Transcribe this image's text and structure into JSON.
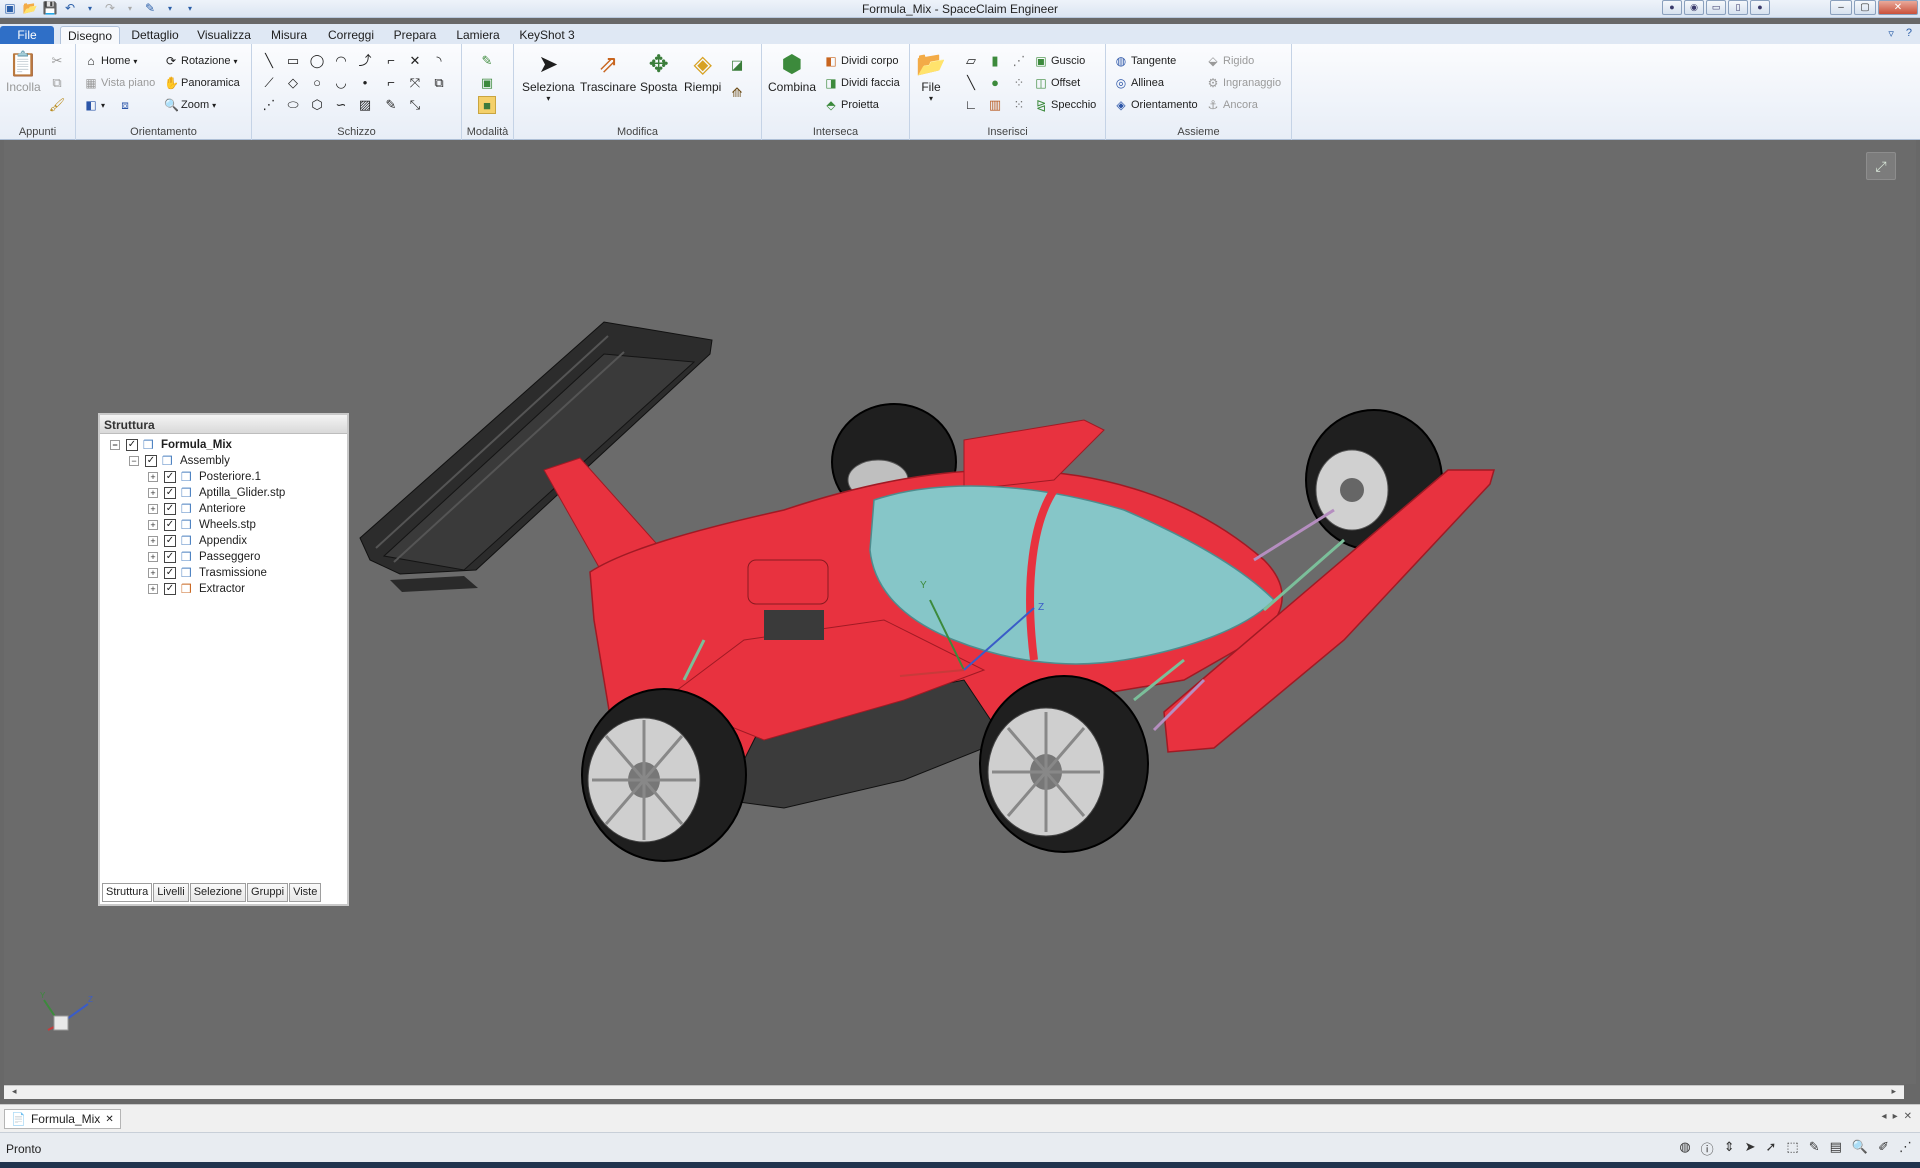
{
  "window": {
    "title": "Formula_Mix - SpaceClaim Engineer"
  },
  "qat": {
    "icons": [
      "app-icon",
      "open-icon",
      "save-icon",
      "undo-icon",
      "redo-icon",
      "sketch-icon",
      "customize-icon"
    ]
  },
  "tabs": [
    {
      "label": "File",
      "left": 0
    },
    {
      "label": "Disegno"
    },
    {
      "label": "Dettaglio"
    },
    {
      "label": "Visualizza"
    },
    {
      "label": "Misura"
    },
    {
      "label": "Correggi"
    },
    {
      "label": "Prepara"
    },
    {
      "label": "Lamiera"
    },
    {
      "label": "KeyShot 3"
    }
  ],
  "ribbon": {
    "appunti": {
      "label": "Appunti",
      "incolla": "Incolla"
    },
    "orientamento": {
      "label": "Orientamento",
      "home": "Home",
      "rotazione": "Rotazione",
      "vista_piano": "Vista piano",
      "panoramica": "Panoramica",
      "zoom": "Zoom"
    },
    "schizzo": {
      "label": "Schizzo"
    },
    "modalita": {
      "label": "Modalità"
    },
    "modifica": {
      "label": "Modifica",
      "seleziona": "Seleziona",
      "trascinare": "Trascinare",
      "sposta": "Sposta",
      "riempi": "Riempi"
    },
    "interseca": {
      "label": "Interseca",
      "combina": "Combina",
      "dividi_corpo": "Dividi corpo",
      "dividi_faccia": "Dividi faccia",
      "proietta": "Proietta"
    },
    "inserisci": {
      "label": "Inserisci",
      "file": "File",
      "guscio": "Guscio",
      "offset": "Offset",
      "specchio": "Specchio"
    },
    "assieme": {
      "label": "Assieme",
      "tangente": "Tangente",
      "allinea": "Allinea",
      "orientamento": "Orientamento",
      "rigido": "Rigido",
      "ingranaggio": "Ingranaggio",
      "ancora": "Ancora"
    }
  },
  "structure": {
    "title": "Struttura",
    "root": "Formula_Mix",
    "assembly": "Assembly",
    "children": [
      "Posteriore.1",
      "Aptilla_Glider.stp",
      "Anteriore",
      "Wheels.stp",
      "Appendix",
      "Passeggero",
      "Trasmissione",
      "Extractor"
    ],
    "tabs": [
      "Struttura",
      "Livelli",
      "Selezione",
      "Gruppi",
      "Viste"
    ]
  },
  "axes": {
    "x": "X",
    "y": "Y",
    "z": "Z"
  },
  "document_tab": "Formula_Mix",
  "status": "Pronto",
  "colors": {
    "body_red": "#e8323f",
    "canopy": "#86c6c8",
    "viewport_bg": "#6b6b6b",
    "tire": "#1f1f1f"
  }
}
